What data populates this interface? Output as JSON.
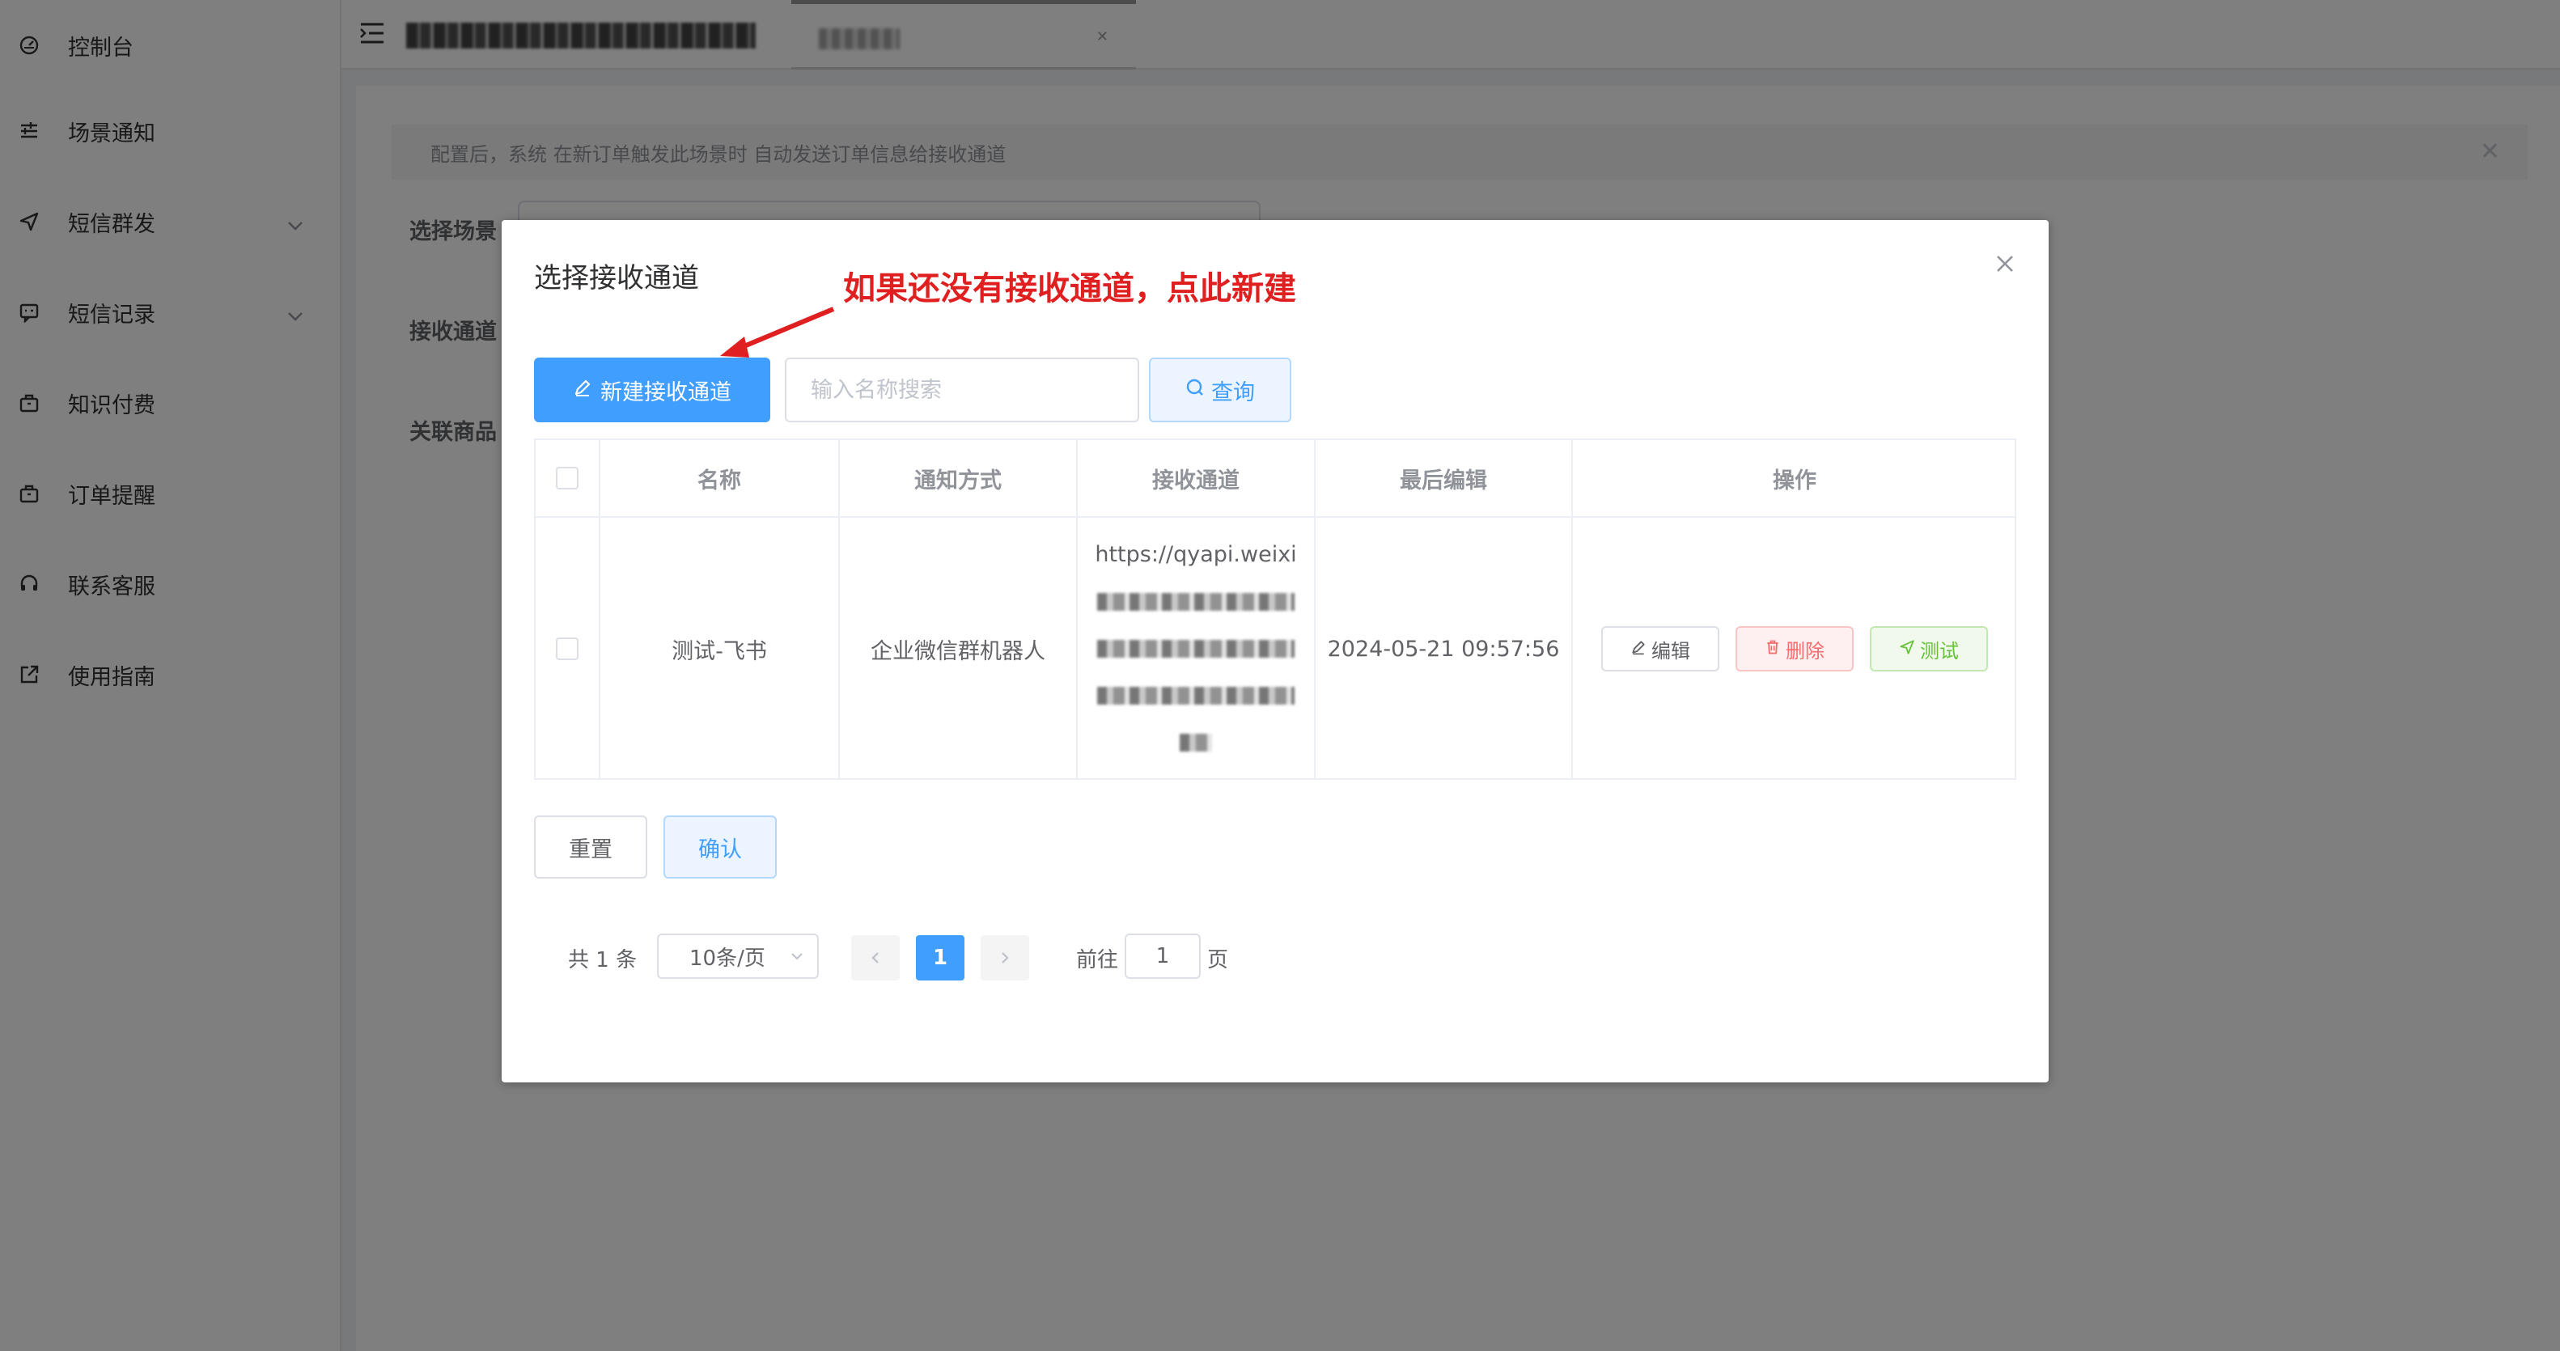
{
  "sidebar": {
    "items": [
      {
        "label": "控制台",
        "icon": "dashboard-icon"
      },
      {
        "label": "场景通知",
        "icon": "sliders-icon"
      },
      {
        "label": "短信群发",
        "icon": "send-icon",
        "expandable": true
      },
      {
        "label": "短信记录",
        "icon": "message-icon",
        "expandable": true
      },
      {
        "label": "知识付费",
        "icon": "briefcase-icon"
      },
      {
        "label": "订单提醒",
        "icon": "briefcase-icon"
      },
      {
        "label": "联系客服",
        "icon": "headset-icon"
      },
      {
        "label": "使用指南",
        "icon": "external-link-icon"
      }
    ]
  },
  "main": {
    "alert": "配置后，系统 在新订单触发此场景时 自动发送订单信息给接收通道",
    "labels": {
      "scene": "选择场景",
      "channel": "接收通道",
      "product": "关联商品"
    }
  },
  "dialog": {
    "title": "选择接收通道",
    "annotation": "如果还没有接收通道，点此新建",
    "new_button": "新建接收通道",
    "search_placeholder": "输入名称搜索",
    "query_button": "查询",
    "table": {
      "headers": [
        "名称",
        "通知方式",
        "接收通道",
        "最后编辑",
        "操作"
      ],
      "rows": [
        {
          "name": "测试-飞书",
          "method": "企业微信群机器人",
          "channel_prefix": "https://qyapi.weixi",
          "last_edit": "2024-05-21 09:57:56",
          "actions": {
            "edit": "编辑",
            "delete": "删除",
            "test": "测试"
          }
        }
      ]
    },
    "reset_button": "重置",
    "confirm_button": "确认",
    "pagination": {
      "total": "共 1 条",
      "page_size": "10条/页",
      "current_page": "1",
      "goto_label": "前往",
      "goto_value": "1",
      "goto_unit": "页"
    }
  },
  "colors": {
    "primary": "#409eff",
    "danger": "#f56c6c",
    "success": "#67c23a",
    "annotation": "#e02020"
  }
}
